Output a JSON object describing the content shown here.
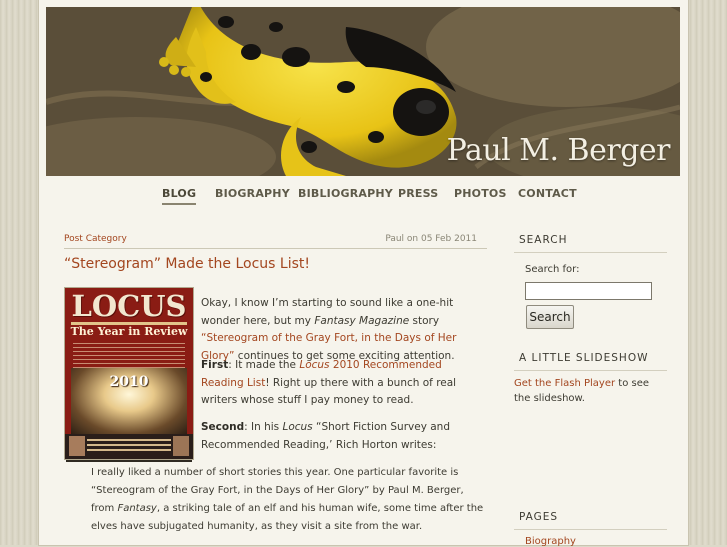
{
  "site": {
    "title": "Paul M. Berger"
  },
  "nav": {
    "items": [
      "BLOG",
      "BIOGRAPHY",
      "BIBLIOGRAPHY",
      "PRESS",
      "PHOTOS",
      "CONTACT"
    ],
    "active": "BLOG"
  },
  "post": {
    "category": "Post Category",
    "date": "Paul on 05 Feb 2011",
    "title": "“Stereogram” Made the Locus List!",
    "p1_a": "Okay, I know I’m starting to sound like a one-hit wonder here, but my ",
    "p1_em": "Fantasy Magazine",
    "p1_b": " story ",
    "p1_link": "“Stereogram of the Gray Fort, in the Days of Her Glory”",
    "p1_c": " continues to get some exciting attention.",
    "p2_label": "First",
    "p2_a": ": It made the ",
    "p2_link_em": "Locus",
    "p2_link": " 2010 Recommended Reading List",
    "p2_b": "!  Right up there with a bunch of real writers whose stuff I pay money to read.",
    "p3_label": "Second",
    "p3_a": ": In his ",
    "p3_em": "Locus",
    "p3_b": " “Short Fiction Survey and Recommended Reading,’ Rich Horton writes:",
    "quote_a": "I really liked a number of short stories this year.  One particular favorite is “Stereogram of the Gray Fort, in the Days of Her Glory” by Paul M. Berger, from ",
    "quote_em": "Fantasy",
    "quote_b": ", a striking tale of an elf and his human wife, some time after the elves have subjugated humanity, as they visit a site from the war."
  },
  "cover": {
    "logo": "LOCUS",
    "headline": "The Year in Review",
    "year": "2010"
  },
  "sidebar": {
    "search_title": "SEARCH",
    "search_label": "Search for:",
    "search_value": "",
    "search_button": "Search",
    "slideshow_title": "A LITTLE SLIDESHOW",
    "slideshow_link": "Get the Flash Player",
    "slideshow_text": " to see the slideshow.",
    "pages_title": "PAGES",
    "pages_items": [
      "Biography"
    ]
  },
  "colors": {
    "accent": "#a3461f",
    "background": "#f6f4ec",
    "text": "#3d3b32"
  },
  "icons": {
    "header_image": "poison-dart-frog-photo"
  }
}
